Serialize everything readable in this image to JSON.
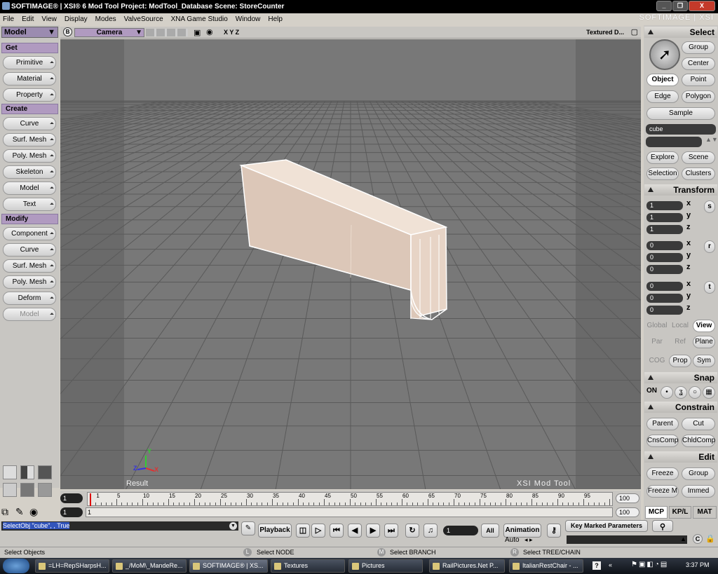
{
  "window": {
    "title": "SOFTIMAGE® | XSI® 6 Mod Tool Project: ModTool_Database    Scene: StoreCounter",
    "brand": "SOFTIMAGE | XSI",
    "controls": [
      "_",
      "❐",
      "X"
    ]
  },
  "menu": [
    "File",
    "Edit",
    "View",
    "Display",
    "Modes",
    "ValveSource",
    "XNA Game Studio",
    "Window",
    "Help"
  ],
  "left": {
    "module": "Model",
    "sections": [
      {
        "title": "Get",
        "items": [
          "Primitive",
          "Material",
          "Property"
        ]
      },
      {
        "title": "Create",
        "items": [
          "Curve",
          "Surf. Mesh",
          "Poly. Mesh",
          "Skeleton",
          "Model",
          "Text"
        ]
      },
      {
        "title": "Modify",
        "items": [
          "Component",
          "Curve",
          "Surf. Mesh",
          "Poly. Mesh",
          "Deform",
          "Model"
        ]
      }
    ]
  },
  "viewport": {
    "camera": "Camera",
    "display_mode": "Textured D...",
    "axes": "X Y Z",
    "result_label": "Result",
    "watermark": "XSI Mod Tool",
    "b_label": "B",
    "gizmo": {
      "y": "Y",
      "z": "Z",
      "x": "X"
    }
  },
  "timeline": {
    "ticks": [
      "1",
      "5",
      "10",
      "15",
      "20",
      "25",
      "30",
      "35",
      "40",
      "45",
      "50",
      "55",
      "60",
      "65",
      "70",
      "75",
      "80",
      "85",
      "90",
      "95"
    ],
    "start": "1",
    "current": "1",
    "end": "100",
    "end2": "100",
    "range_start": "1",
    "range_current": "1"
  },
  "right": {
    "select": {
      "title": "Select",
      "group": "Group",
      "center": "Center",
      "object": "Object",
      "point": "Point",
      "edge": "Edge",
      "polygon": "Polygon",
      "sample": "Sample",
      "name": "cube",
      "explore": "Explore",
      "scene": "Scene",
      "selection": "Selection",
      "clusters": "Clusters"
    },
    "transform": {
      "title": "Transform",
      "scale": [
        "1",
        "1",
        "1"
      ],
      "rotate": [
        "0",
        "0",
        "0"
      ],
      "translate": [
        "0",
        "0",
        "0"
      ],
      "axes": [
        "x",
        "y",
        "z"
      ],
      "ops": [
        "s",
        "r",
        "t"
      ],
      "global": "Global",
      "local": "Local",
      "view": "View",
      "par": "Par",
      "ref": "Ref",
      "plane": "Plane",
      "cog": "COG",
      "prop": "Prop",
      "sym": "Sym"
    },
    "snap": {
      "title": "Snap",
      "on": "ON"
    },
    "constrain": {
      "title": "Constrain",
      "parent": "Parent",
      "cut": "Cut",
      "cnscomp": "CnsComp",
      "chldcomp": "ChldComp"
    },
    "edit": {
      "title": "Edit",
      "freeze": "Freeze",
      "group": "Group",
      "freezem": "Freeze M",
      "immed": "Immed"
    },
    "tabs": [
      "MCP",
      "KP/L",
      "MAT"
    ]
  },
  "command": {
    "script": "SelectObj \"cube\", , True",
    "playback": "Playback",
    "frame": "1",
    "all": "All",
    "animation": "Animation",
    "auto": "Auto",
    "key_marked": "Key Marked Parameters"
  },
  "status": {
    "left": "Select Objects",
    "l_key": "L",
    "l_text": "Select NODE",
    "m_key": "M",
    "m_text": "Select BRANCH",
    "r_key": "R",
    "r_text": "Select TREE/CHAIN"
  },
  "taskbar": {
    "tasks": [
      "=LH=RepSHarpsH...",
      "_/MoM\\_MandeRe...",
      "SOFTIMAGE® | XS...",
      "Textures",
      "Pictures",
      "RailPictures.Net P...",
      "ItalianRestChair - ..."
    ],
    "clock": "3:37 PM"
  },
  "colors": {
    "viewport_bg": "#6e6e6e",
    "header_purple": "#b09ac0",
    "object_color": "#e8d8cc"
  }
}
